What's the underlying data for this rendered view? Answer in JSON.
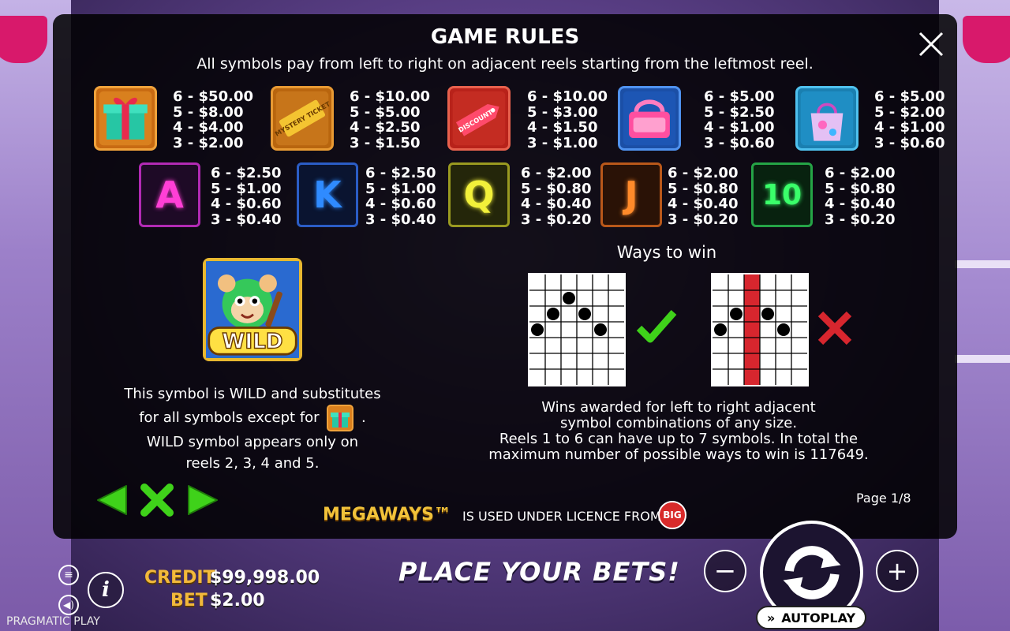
{
  "rules": {
    "title": "GAME RULES",
    "subtitle": "All symbols pay from left to right on adjacent reels starting from the leftmost reel.",
    "high_symbols": [
      {
        "icon": "gift-box-icon",
        "pays": "6 - $50.00\n5 - $8.00\n4 - $4.00\n3 - $2.00"
      },
      {
        "icon": "mystery-ticket-icon",
        "label": "MYSTERY TICKET",
        "pays": "6 - $10.00\n5 - $5.00\n4 - $2.50\n3 - $1.50"
      },
      {
        "icon": "discount-tag-icon",
        "label": "DISCOUNT",
        "pays": "6 - $10.00\n5 - $3.00\n4 - $1.50\n3 - $1.00"
      },
      {
        "icon": "handbag-pink-icon",
        "pays": "6 - $5.00\n5 - $2.50\n4 - $1.00\n3 - $0.60"
      },
      {
        "icon": "shopping-bag-icon",
        "pays": "6 - $5.00\n5 - $2.00\n4 - $1.00\n3 - $0.60"
      }
    ],
    "low_symbols": [
      {
        "letter": "A",
        "color": "#ff3fd6",
        "pays": "6 - $2.50\n5 - $1.00\n4 - $0.60\n3 - $0.40"
      },
      {
        "letter": "K",
        "color": "#2f8bff",
        "pays": "6 - $2.50\n5 - $1.00\n4 - $0.60\n3 - $0.40"
      },
      {
        "letter": "Q",
        "color": "#f2f03a",
        "pays": "6 - $2.00\n5 - $0.80\n4 - $0.40\n3 - $0.20"
      },
      {
        "letter": "J",
        "color": "#ff8a2a",
        "pays": "6 - $2.00\n5 - $0.80\n4 - $0.40\n3 - $0.20"
      },
      {
        "letter": "10",
        "color": "#3aff6a",
        "pays": "6 - $2.00\n5 - $0.80\n4 - $0.40\n3 - $0.20"
      }
    ],
    "wild": {
      "label": "WILD",
      "line1": "This symbol is WILD and substitutes",
      "line2": "for all symbols except for",
      "line2_end": ".",
      "line3": "WILD symbol appears only on",
      "line4": "reels 2, 3, 4 and 5."
    },
    "ways": {
      "title": "Ways to win",
      "line1": "Wins awarded for left to right adjacent",
      "line2": "symbol combinations of any size.",
      "line3": "Reels 1 to 6 can have up to 7 symbols. In total the",
      "line4": "maximum number of possible ways to win is 117649."
    },
    "page": "Page 1/8",
    "megaways": "MEGAWAYS™",
    "licence": "IS USED UNDER LICENCE FROM",
    "licence_logo": "BIG"
  },
  "bottom": {
    "credit_label": "CREDIT",
    "credit_value": "$99,998.00",
    "bet_label": "BET",
    "bet_value": "$2.00",
    "message": "PLACE YOUR BETS!",
    "autoplay": "AUTOPLAY",
    "provider": "PRAGMATIC PLAY"
  },
  "colors": {
    "accent_green": "#3fd21a",
    "cross_red": "#d7262e",
    "credit_gold": "#f2b93b"
  }
}
